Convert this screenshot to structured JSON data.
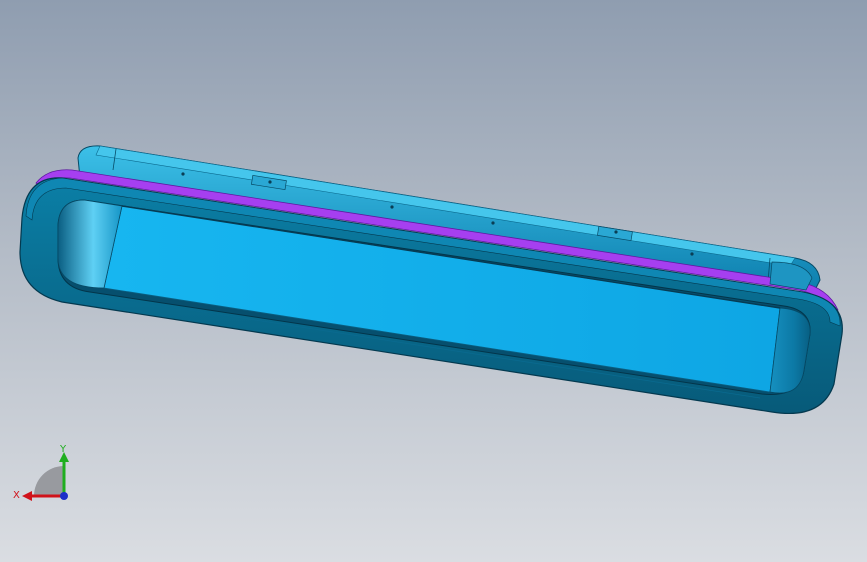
{
  "viewport": {
    "background_top": "#8f9db0",
    "background_bottom": "#dadde2"
  },
  "model": {
    "frame_color": "#0b6e93",
    "shell_color": "#1f9dc9",
    "pocket_color": "#12aeea",
    "gasket_color": "#a23fe8"
  },
  "triad": {
    "x_label": "X",
    "y_label": "Y",
    "x_color": "#d0121a",
    "y_color": "#1fae1f",
    "z_color": "#1b2ec8"
  }
}
